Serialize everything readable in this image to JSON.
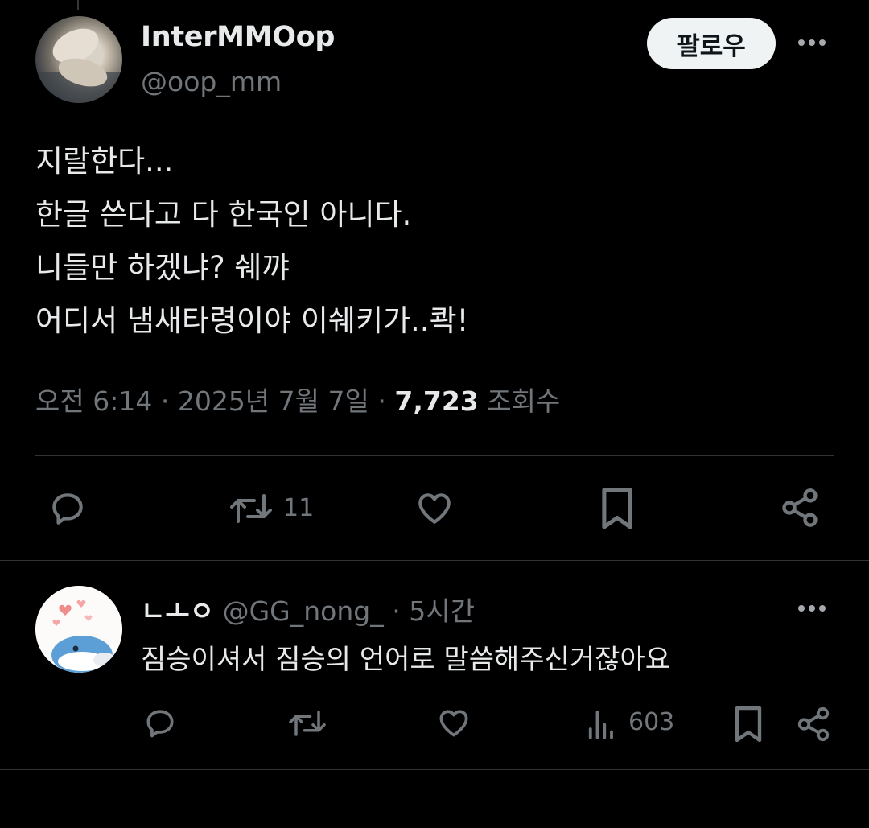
{
  "main_tweet": {
    "display_name": "InterMMOop",
    "handle": "@oop_mm",
    "follow_label": "팔로우",
    "text_lines": [
      "지랄한다...",
      "한글 쓴다고 다 한국인 아니다.",
      "니들만 하겠냐? 쉐꺄",
      "어디서 냄새타령이야 이쉐키가..콱!"
    ],
    "time": "오전 6:14",
    "date": "2025년 7월 7일",
    "separator": "·",
    "views_count": "7,723",
    "views_label": "조회수",
    "actions": {
      "retweet_count": "11"
    }
  },
  "reply": {
    "display_name": "ㄴㅗㅇ",
    "handle": "@GG_nong_",
    "separator": "·",
    "time_ago": "5시간",
    "text": "짐승이셔서 짐승의 언어로 말씀해주신거잖아요",
    "views_count": "603"
  },
  "icons": {
    "reply": "reply-bubble-icon",
    "retweet": "retweet-icon",
    "like": "heart-icon",
    "bookmark": "bookmark-icon",
    "share": "share-icon",
    "views": "bar-chart-icon",
    "more": "more-dots-icon"
  },
  "colors": {
    "background": "#000000",
    "text_primary": "#e7e9ea",
    "text_secondary": "#71767b",
    "follow_button_bg": "#eff3f4",
    "divider": "#2f3336"
  }
}
